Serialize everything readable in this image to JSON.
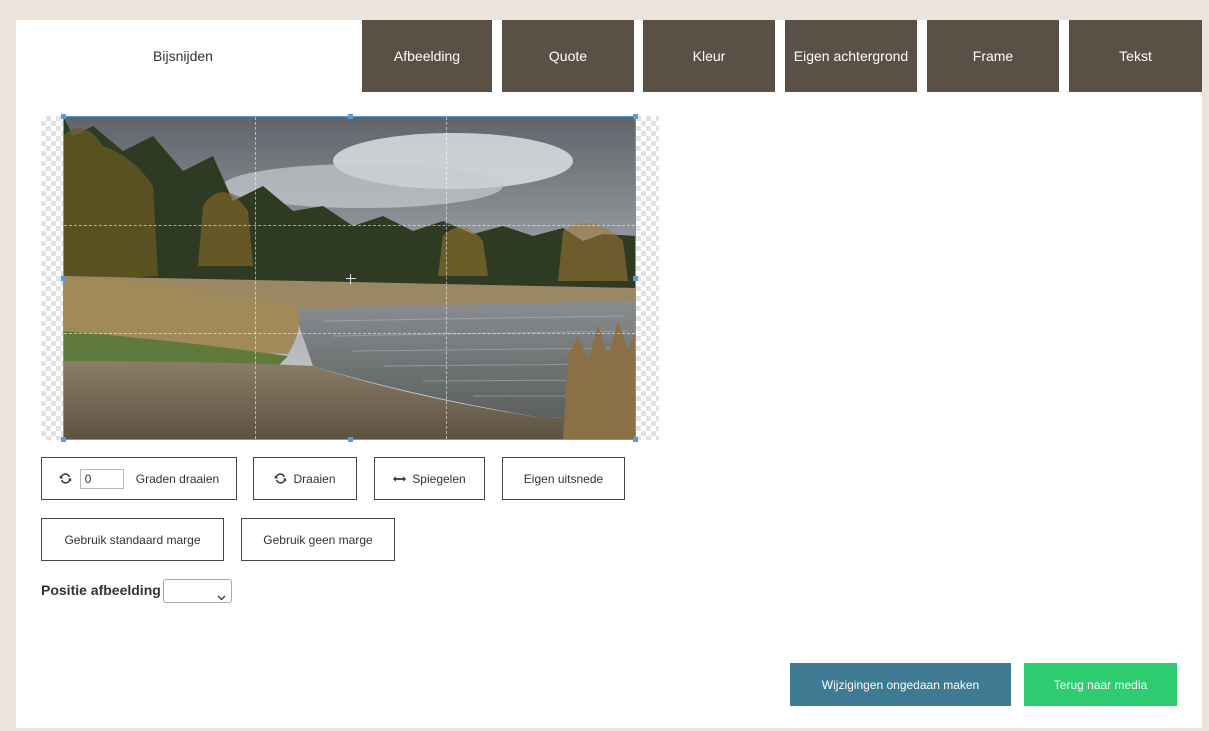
{
  "tabs": [
    {
      "label": "Bijsnijden",
      "active": true
    },
    {
      "label": "Afbeelding",
      "active": false
    },
    {
      "label": "Quote",
      "active": false
    },
    {
      "label": "Kleur",
      "active": false
    },
    {
      "label": "Eigen achtergrond",
      "active": false
    },
    {
      "label": "Frame",
      "active": false
    },
    {
      "label": "Tekst",
      "active": false
    }
  ],
  "crop": {
    "degrees_value": "0"
  },
  "toolbar": {
    "rotate_degrees_label": "Graden draaien",
    "rotate_label": "Draaien",
    "mirror_label": "Spiegelen",
    "custom_crop_label": "Eigen uitsnede",
    "standard_margin_label": "Gebruik standaard marge",
    "no_margin_label": "Gebruik geen marge"
  },
  "position": {
    "label": "Positie afbeelding",
    "selected": ""
  },
  "actions": {
    "undo_label": "Wijzigingen ongedaan maken",
    "back_label": "Terug naar media"
  },
  "colors": {
    "tab_bg": "#5b5046",
    "page_bg": "#ece4da",
    "undo_bg": "#3f7a93",
    "back_bg": "#2ecc71",
    "crop_border": "#5a9bd9"
  },
  "icons": {
    "rotate": "refresh-icon",
    "mirror": "horizontal-arrows-icon",
    "select": "chevron-down-icon"
  }
}
